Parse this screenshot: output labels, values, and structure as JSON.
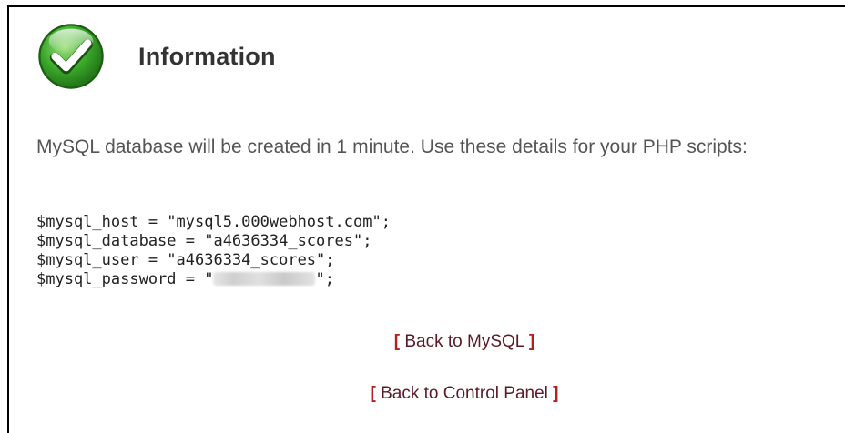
{
  "header": {
    "icon": "check-circle-icon",
    "title": "Information"
  },
  "message": "MySQL database will be created in 1 minute. Use these details for your PHP scripts:",
  "code": {
    "host_line": "$mysql_host = \"mysql5.000webhost.com\";",
    "database_line": "$mysql_database = \"a4636334_scores\";",
    "user_line": "$mysql_user = \"a4636334_scores\";",
    "password_prefix": "$mysql_password = \"",
    "password_suffix": "\";"
  },
  "links": {
    "bracket_open": "[",
    "bracket_close": "]",
    "back_to_mysql": "Back to MySQL",
    "back_to_control_panel": "Back to Control Panel"
  },
  "colors": {
    "icon_green": "#3aa82a",
    "bracket": "#b42020",
    "link": "#5a1a2a",
    "text": "#555555"
  }
}
